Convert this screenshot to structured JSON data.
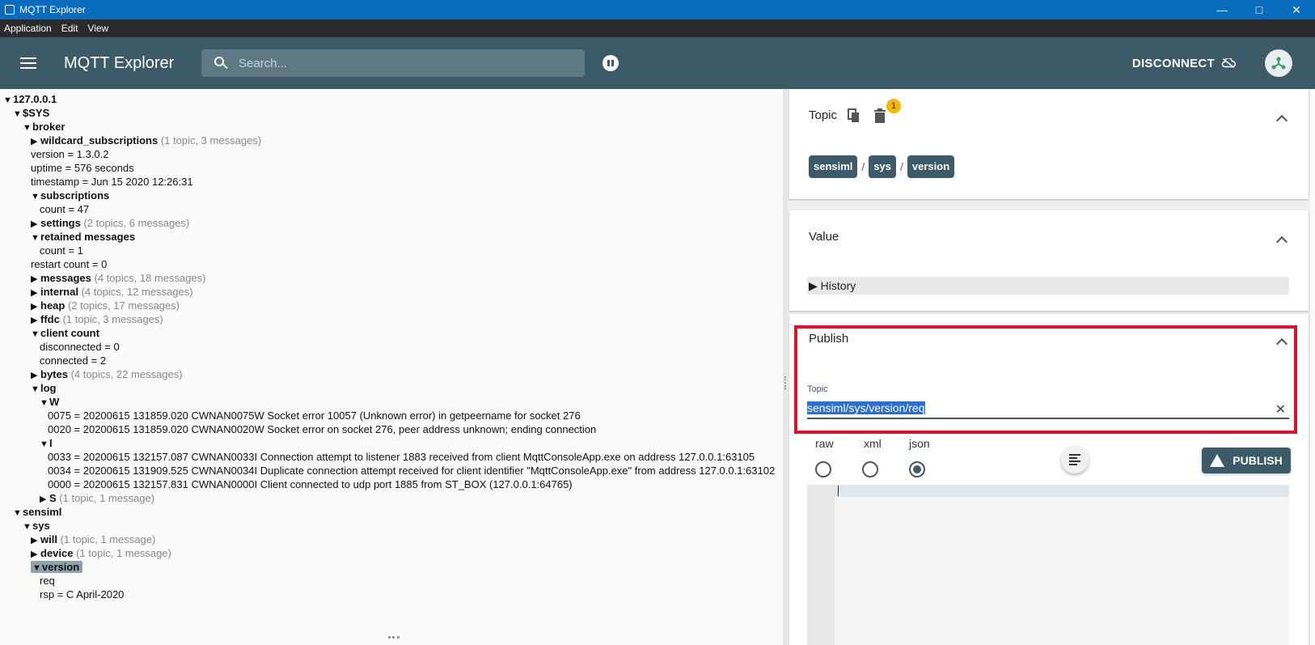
{
  "window": {
    "title": "MQTT Explorer"
  },
  "menu": [
    "Application",
    "Edit",
    "View"
  ],
  "appbar": {
    "title": "MQTT Explorer",
    "search_placeholder": "Search...",
    "disconnect_label": "DISCONNECT"
  },
  "tree": [
    {
      "indent": 0,
      "tri": "▼",
      "label": "127.0.0.1",
      "meta": ""
    },
    {
      "indent": 1,
      "tri": "▼",
      "label": "$SYS",
      "meta": ""
    },
    {
      "indent": 2,
      "tri": "▼",
      "label": "broker",
      "meta": ""
    },
    {
      "indent": 3,
      "tri": "▶",
      "label": "wildcard_subscriptions",
      "meta": " (1 topic, 3 messages)"
    },
    {
      "indent": 3,
      "tri": "",
      "label": "version",
      "value": " = 1.3.0.2"
    },
    {
      "indent": 3,
      "tri": "",
      "label": "uptime",
      "value": " = 576 seconds"
    },
    {
      "indent": 3,
      "tri": "",
      "label": "timestamp",
      "value": " = Jun 15 2020 12:26:31"
    },
    {
      "indent": 3,
      "tri": "▼",
      "label": "subscriptions",
      "meta": ""
    },
    {
      "indent": 4,
      "tri": "",
      "label": "count",
      "value": " = 47"
    },
    {
      "indent": 3,
      "tri": "▶",
      "label": "settings",
      "meta": " (2 topics, 6 messages)"
    },
    {
      "indent": 3,
      "tri": "▼",
      "label": "retained messages",
      "meta": ""
    },
    {
      "indent": 4,
      "tri": "",
      "label": "count",
      "value": " = 1"
    },
    {
      "indent": 3,
      "tri": "",
      "label": "restart count",
      "value": " = 0"
    },
    {
      "indent": 3,
      "tri": "▶",
      "label": "messages",
      "meta": " (4 topics, 18 messages)"
    },
    {
      "indent": 3,
      "tri": "▶",
      "label": "internal",
      "meta": " (4 topics, 12 messages)"
    },
    {
      "indent": 3,
      "tri": "▶",
      "label": "heap",
      "meta": " (2 topics, 17 messages)"
    },
    {
      "indent": 3,
      "tri": "▶",
      "label": "ffdc",
      "meta": " (1 topic, 3 messages)"
    },
    {
      "indent": 3,
      "tri": "▼",
      "label": "client count",
      "meta": ""
    },
    {
      "indent": 4,
      "tri": "",
      "label": "disconnected",
      "value": " = 0"
    },
    {
      "indent": 4,
      "tri": "",
      "label": "connected",
      "value": " = 2"
    },
    {
      "indent": 3,
      "tri": "▶",
      "label": "bytes",
      "meta": " (4 topics, 22 messages)"
    },
    {
      "indent": 3,
      "tri": "▼",
      "label": "log",
      "meta": ""
    },
    {
      "indent": 4,
      "tri": "▼",
      "label": "W",
      "meta": ""
    },
    {
      "indent": 5,
      "tri": "",
      "label": "0075",
      "value": " = 20200615 131859.020 CWNAN0075W Socket error 10057 (Unknown error) in getpeername for socket 276"
    },
    {
      "indent": 5,
      "tri": "",
      "label": "0020",
      "value": " = 20200615 131859.020 CWNAN0020W Socket error on socket 276, peer address unknown; ending connection"
    },
    {
      "indent": 4,
      "tri": "▼",
      "label": "I",
      "meta": ""
    },
    {
      "indent": 5,
      "tri": "",
      "label": "0033",
      "value": " = 20200615 132157.087 CWNAN0033I Connection attempt to listener 1883 received from client MqttConsoleApp.exe on address 127.0.0.1:63105"
    },
    {
      "indent": 5,
      "tri": "",
      "label": "0034",
      "value": " = 20200615 131909.525 CWNAN0034I Duplicate connection attempt received for client identifier \"MqttConsoleApp.exe\" from address 127.0.0.1:63102"
    },
    {
      "indent": 5,
      "tri": "",
      "label": "0000",
      "value": " = 20200615 132157.831 CWNAN0000I Client connected to udp port 1885 from ST_BOX (127.0.0.1:64765)"
    },
    {
      "indent": 4,
      "tri": "▶",
      "label": "S",
      "meta": " (1 topic, 1 message)"
    },
    {
      "indent": 1,
      "tri": "▼",
      "label": "sensiml",
      "meta": ""
    },
    {
      "indent": 2,
      "tri": "▼",
      "label": "sys",
      "meta": ""
    },
    {
      "indent": 3,
      "tri": "▶",
      "label": "will",
      "meta": " (1 topic, 1 message)"
    },
    {
      "indent": 3,
      "tri": "▶",
      "label": "device",
      "meta": " (1 topic, 1 message)"
    },
    {
      "indent": 3,
      "tri": "▼",
      "label": "version",
      "meta": "",
      "selected": true
    },
    {
      "indent": 4,
      "tri": "",
      "label": "req",
      "value": ""
    },
    {
      "indent": 4,
      "tri": "",
      "label": "rsp",
      "value": " = C April-2020"
    }
  ],
  "topic_panel": {
    "title": "Topic",
    "badge": "1",
    "breadcrumb": [
      "sensiml",
      "sys",
      "version"
    ],
    "separator": "/"
  },
  "value_panel": {
    "title": "Value",
    "history_label": "History"
  },
  "publish_panel": {
    "title": "Publish",
    "topic_label": "Topic",
    "topic_value": "sensiml/sys/version/req",
    "formats": [
      "raw",
      "xml",
      "json"
    ],
    "selected_format": "json",
    "publish_label": "PUBLISH"
  }
}
